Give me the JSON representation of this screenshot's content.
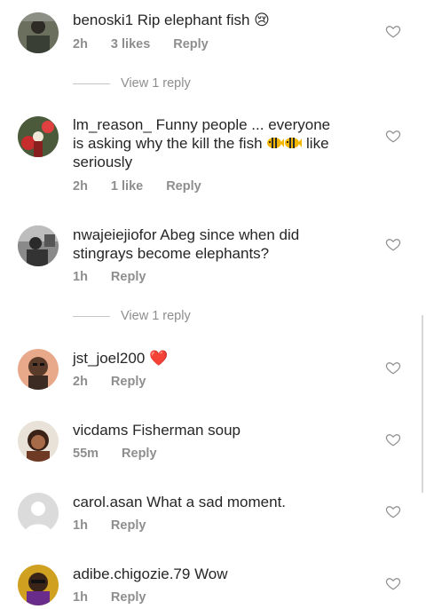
{
  "comments": [
    {
      "username": "benoski1",
      "text": "Rip elephant fish",
      "emoji": "😢",
      "time": "2h",
      "likes": "3 likes",
      "reply": "Reply",
      "view_replies": "View 1 reply"
    },
    {
      "username": "lm_reason_",
      "text_line1": "Funny people ... everyone",
      "text_line2": "is asking why the kill the fish",
      "text_line3": "seriously",
      "text_tail": "like",
      "time": "2h",
      "likes": "1 like",
      "reply": "Reply"
    },
    {
      "username": "nwajeiejiofor",
      "text_line1": "Abeg since when did",
      "text_line2": "stingrays become elephants?",
      "time": "1h",
      "reply": "Reply",
      "view_replies": "View 1 reply"
    },
    {
      "username": "jst_joel200",
      "emoji": "❤️",
      "time": "2h",
      "reply": "Reply"
    },
    {
      "username": "vicdams",
      "text": "Fisherman soup",
      "time": "55m",
      "reply": "Reply"
    },
    {
      "username": "carol.asan",
      "text": "What a sad moment.",
      "time": "1h",
      "reply": "Reply"
    },
    {
      "username": "adibe.chigozie.79",
      "text": "Wow",
      "time": "1h",
      "reply": "Reply"
    }
  ],
  "colors": {
    "text": "#262626",
    "muted": "#8e8e8e",
    "heart_red": "#d8232a"
  }
}
